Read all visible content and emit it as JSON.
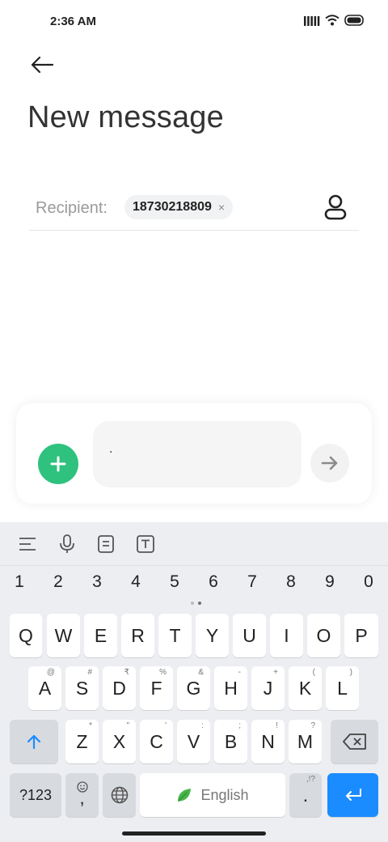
{
  "status_bar": {
    "time": "2:36 AM"
  },
  "header": {
    "title": "New message"
  },
  "recipient": {
    "label": "Recipient:",
    "chip_number": "18730218809",
    "chip_close": "×"
  },
  "composer": {
    "message_text": "."
  },
  "keyboard": {
    "numbers": [
      "1",
      "2",
      "3",
      "4",
      "5",
      "6",
      "7",
      "8",
      "9",
      "0"
    ],
    "row1": [
      "Q",
      "W",
      "E",
      "R",
      "T",
      "Y",
      "U",
      "I",
      "O",
      "P"
    ],
    "row2": [
      {
        "key": "A",
        "hint": "@"
      },
      {
        "key": "S",
        "hint": "#"
      },
      {
        "key": "D",
        "hint": "₹"
      },
      {
        "key": "F",
        "hint": "%"
      },
      {
        "key": "G",
        "hint": "&"
      },
      {
        "key": "H",
        "hint": "-"
      },
      {
        "key": "J",
        "hint": "+"
      },
      {
        "key": "K",
        "hint": "("
      },
      {
        "key": "L",
        "hint": ")"
      }
    ],
    "row3": [
      {
        "key": "Z",
        "hint": "*"
      },
      {
        "key": "X",
        "hint": "\""
      },
      {
        "key": "C",
        "hint": "'"
      },
      {
        "key": "V",
        "hint": ":"
      },
      {
        "key": "B",
        "hint": ";"
      },
      {
        "key": "N",
        "hint": "!"
      },
      {
        "key": "M",
        "hint": "?"
      }
    ],
    "symbols_label": "?123",
    "comma_label": ",",
    "space_label": "English",
    "period_label": ".",
    "period_hint": ",!?"
  },
  "colors": {
    "accent_green": "#2ec27e",
    "enter_blue": "#1a8cff",
    "keyboard_bg": "#eceef1"
  }
}
